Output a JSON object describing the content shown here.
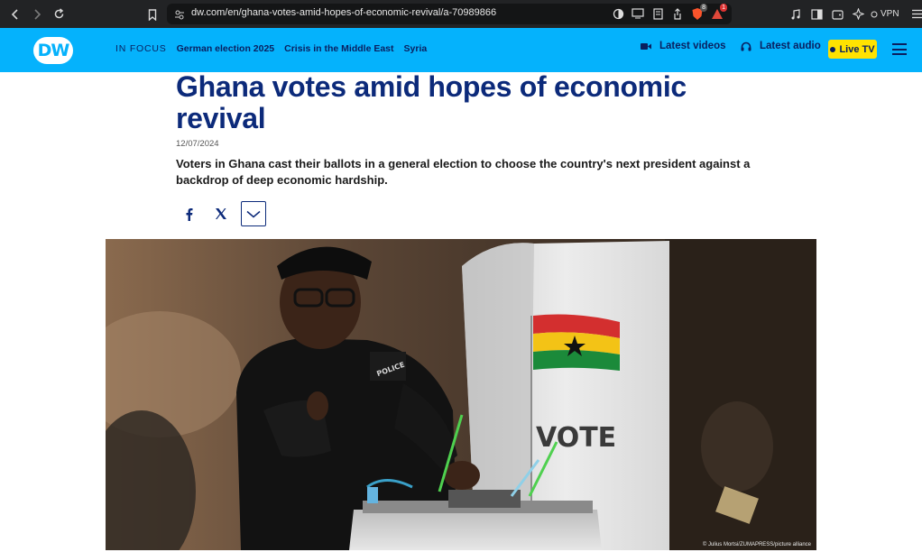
{
  "browser": {
    "url": "dw.com/en/ghana-votes-amid-hopes-of-economic-revival/a-70989866",
    "shield_count": "8",
    "alert_count": "1",
    "vpn_label": "VPN"
  },
  "header": {
    "logo_text": "DW",
    "nav": {
      "in_focus": "IN FOCUS",
      "links": [
        "German election 2025",
        "Crisis in the Middle East",
        "Syria"
      ]
    },
    "latest_videos": "Latest videos",
    "latest_audio": "Latest audio",
    "live_tv": "Live TV"
  },
  "article": {
    "headline": "Ghana votes amid hopes of economic revival",
    "date": "12/07/2024",
    "teaser": "Voters in Ghana cast their ballots in a general election to choose the country's next president against a backdrop of deep economic hardship.",
    "photo": {
      "sign_text": "VOTE",
      "badge_text": "POLICE",
      "credit": "© Julius Mortsi/ZUMAPRESS/picture alliance"
    }
  },
  "colors": {
    "dw_blue": "#05b2fc",
    "navy": "#0c2a7a",
    "live_yellow": "#ffe200"
  }
}
